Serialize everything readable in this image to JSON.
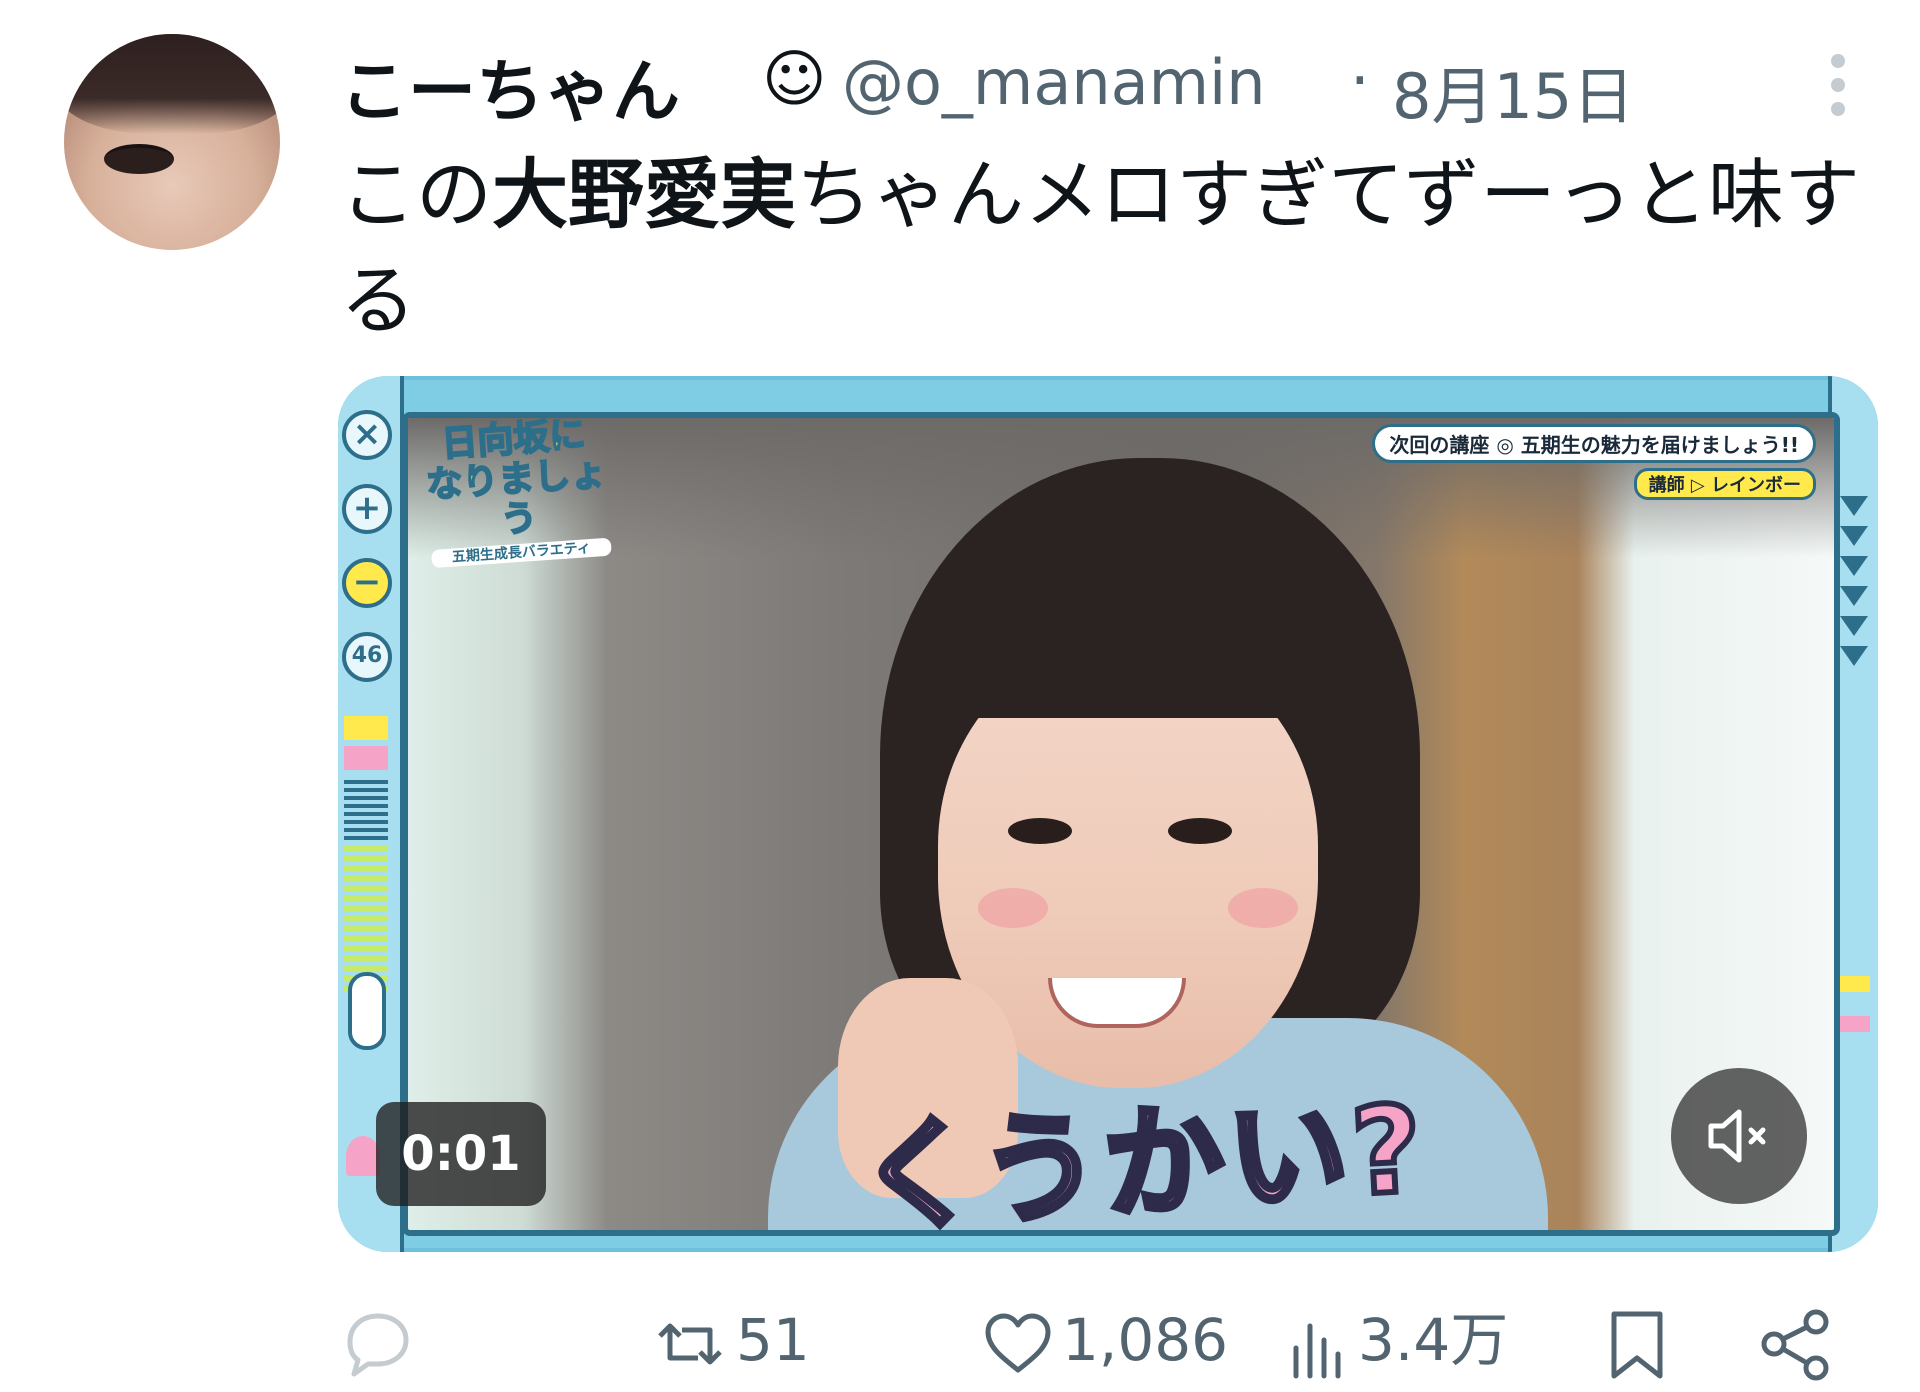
{
  "tweet": {
    "display_name": "こーちゃん",
    "name_emoji": "☺",
    "handle": "@o_manamin",
    "separator": "·",
    "date": "8月15日",
    "text_part1": "この",
    "text_highlight": "大野愛実",
    "text_part2": "ちゃんメロすぎてずーっと味する"
  },
  "media": {
    "logo_line1": "日向坂に",
    "logo_line2": "なりましょう",
    "logo_sub": "五期生成長バラエティ",
    "ribbon": "次回の講座 ◎ 五期生の魅力を届けましょう!!",
    "ribbon2": "講師 ▷ レインボー",
    "side_badge": "46",
    "caption": "くうかい?",
    "timestamp": "0:01",
    "mute_icon": "speaker-muted-icon"
  },
  "actions": {
    "reply_icon": "reply-icon",
    "retweet_count": "51",
    "like_count": "1,086",
    "views_count": "3.4万",
    "bookmark_icon": "bookmark-icon",
    "share_icon": "share-icon"
  },
  "colors": {
    "text": "#0f1419",
    "secondary": "#536471",
    "frame": "#7fcde4",
    "caption_pink": "#f5a3c7"
  }
}
